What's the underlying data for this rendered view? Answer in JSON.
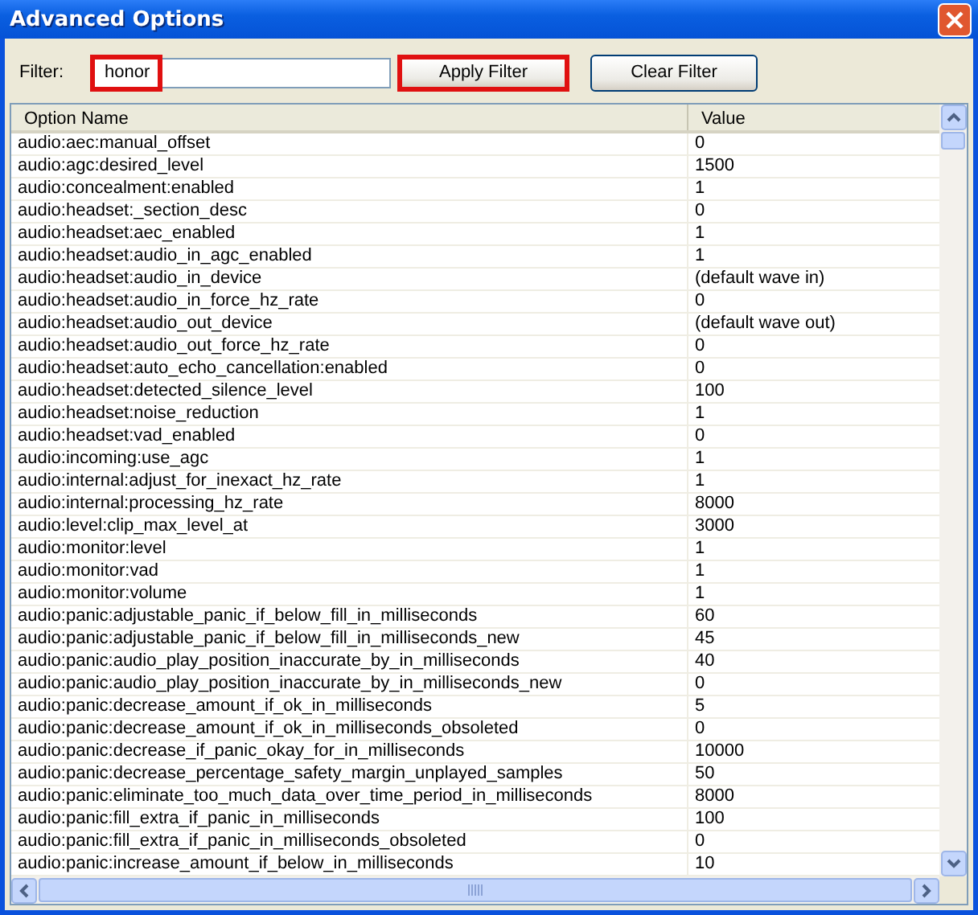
{
  "window": {
    "title": "Advanced Options"
  },
  "filter": {
    "label": "Filter:",
    "value": "honor",
    "highlighted": true
  },
  "buttons": [
    {
      "label": "Apply Filter",
      "highlighted": true
    },
    {
      "label": "Clear Filter",
      "highlighted": false
    }
  ],
  "table": {
    "columns": [
      "Option Name",
      "Value"
    ],
    "rows": [
      [
        "audio:aec:manual_offset",
        "0"
      ],
      [
        "audio:agc:desired_level",
        "1500"
      ],
      [
        "audio:concealment:enabled",
        "1"
      ],
      [
        "audio:headset:_section_desc",
        "0"
      ],
      [
        "audio:headset:aec_enabled",
        "1"
      ],
      [
        "audio:headset:audio_in_agc_enabled",
        "1"
      ],
      [
        "audio:headset:audio_in_device",
        "(default wave in)"
      ],
      [
        "audio:headset:audio_in_force_hz_rate",
        "0"
      ],
      [
        "audio:headset:audio_out_device",
        "(default wave out)"
      ],
      [
        "audio:headset:audio_out_force_hz_rate",
        "0"
      ],
      [
        "audio:headset:auto_echo_cancellation:enabled",
        "0"
      ],
      [
        "audio:headset:detected_silence_level",
        "100"
      ],
      [
        "audio:headset:noise_reduction",
        "1"
      ],
      [
        "audio:headset:vad_enabled",
        "0"
      ],
      [
        "audio:incoming:use_agc",
        "1"
      ],
      [
        "audio:internal:adjust_for_inexact_hz_rate",
        "1"
      ],
      [
        "audio:internal:processing_hz_rate",
        "8000"
      ],
      [
        "audio:level:clip_max_level_at",
        "3000"
      ],
      [
        "audio:monitor:level",
        "1"
      ],
      [
        "audio:monitor:vad",
        "1"
      ],
      [
        "audio:monitor:volume",
        "1"
      ],
      [
        "audio:panic:adjustable_panic_if_below_fill_in_milliseconds",
        "60"
      ],
      [
        "audio:panic:adjustable_panic_if_below_fill_in_milliseconds_new",
        "45"
      ],
      [
        "audio:panic:audio_play_position_inaccurate_by_in_milliseconds",
        "40"
      ],
      [
        "audio:panic:audio_play_position_inaccurate_by_in_milliseconds_new",
        "0"
      ],
      [
        "audio:panic:decrease_amount_if_ok_in_milliseconds",
        "5"
      ],
      [
        "audio:panic:decrease_amount_if_ok_in_milliseconds_obsoleted",
        "0"
      ],
      [
        "audio:panic:decrease_if_panic_okay_for_in_milliseconds",
        "10000"
      ],
      [
        "audio:panic:decrease_percentage_safety_margin_unplayed_samples",
        "50"
      ],
      [
        "audio:panic:eliminate_too_much_data_over_time_period_in_milliseconds",
        "8000"
      ],
      [
        "audio:panic:fill_extra_if_panic_in_milliseconds",
        "100"
      ],
      [
        "audio:panic:fill_extra_if_panic_in_milliseconds_obsoleted",
        "0"
      ],
      [
        "audio:panic:increase_amount_if_below_in_milliseconds",
        "10"
      ]
    ]
  }
}
